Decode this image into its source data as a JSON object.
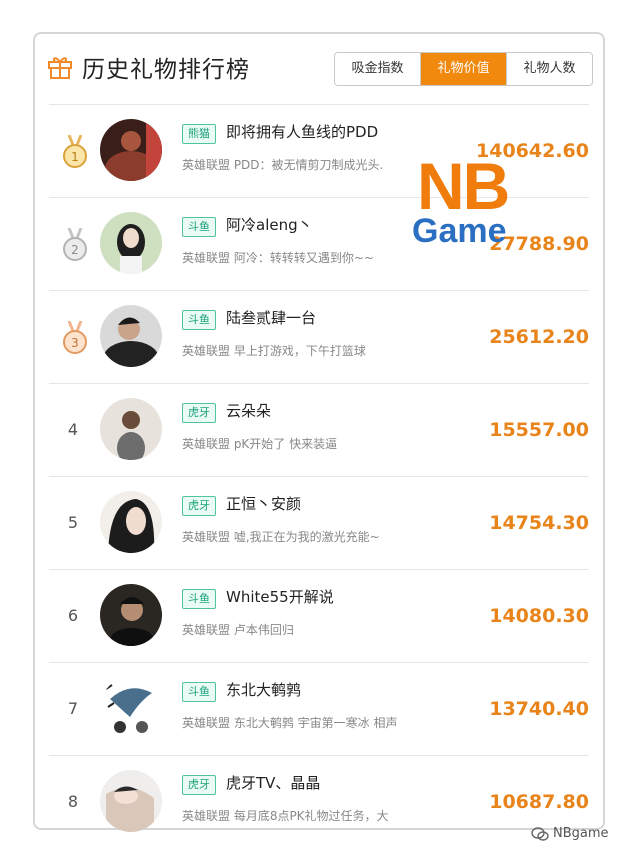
{
  "header": {
    "title": "历史礼物排行榜",
    "tabs": [
      {
        "label": "吸金指数",
        "active": false
      },
      {
        "label": "礼物价值",
        "active": true
      },
      {
        "label": "礼物人数",
        "active": false
      }
    ]
  },
  "rows": [
    {
      "rank": "1",
      "medal": "gold",
      "platform": "熊猫",
      "name": "即将拥有人鱼线的PDD",
      "desc": "英雄联盟 PDD：被无情剪刀制成光头.",
      "value": "140642.60"
    },
    {
      "rank": "2",
      "medal": "silver",
      "platform": "斗鱼",
      "name": "阿冷aleng丶",
      "desc": "英雄联盟 阿冷：转转转又遇到你~~",
      "value": "27788.90"
    },
    {
      "rank": "3",
      "medal": "bronze",
      "platform": "斗鱼",
      "name": "陆叁贰肆一台",
      "desc": "英雄联盟 早上打游戏，下午打篮球",
      "value": "25612.20"
    },
    {
      "rank": "4",
      "medal": "",
      "platform": "虎牙",
      "name": "云朵朵",
      "desc": "英雄联盟 pK开始了 快来装逼",
      "value": "15557.00"
    },
    {
      "rank": "5",
      "medal": "",
      "platform": "虎牙",
      "name": "正恒丶安颜",
      "desc": "英雄联盟 嘘,我正在为我的激光充能~",
      "value": "14754.30"
    },
    {
      "rank": "6",
      "medal": "",
      "platform": "斗鱼",
      "name": "White55开解说",
      "desc": "英雄联盟 卢本伟回归",
      "value": "14080.30"
    },
    {
      "rank": "7",
      "medal": "",
      "platform": "斗鱼",
      "name": "东北大鹌鹑",
      "desc": "英雄联盟 东北大鹌鹑 宇宙第一寒冰 相声",
      "value": "13740.40"
    },
    {
      "rank": "8",
      "medal": "",
      "platform": "虎牙",
      "name": "虎牙TV、晶晶",
      "desc": "英雄联盟 每月底8点PK礼物过任务，大",
      "value": "10687.80"
    }
  ],
  "watermark": {
    "nb": "NB",
    "game": "Game"
  },
  "footer": {
    "brand": "NBgame"
  },
  "colors": {
    "accent": "#f0890e",
    "value": "#e8841a",
    "platform": "#1aa37a"
  }
}
